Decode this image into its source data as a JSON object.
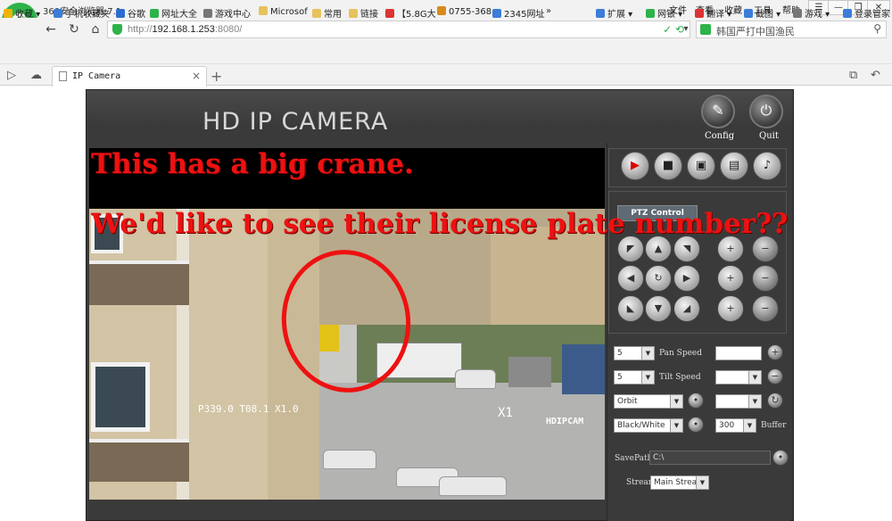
{
  "browser": {
    "logo_letter": "e",
    "app_title": "360安全浏览器 7.1",
    "menu": [
      "文件",
      "查看",
      "收藏",
      "工具",
      "帮助"
    ],
    "window_buttons": [
      "☰",
      "—",
      "❐",
      "✕"
    ],
    "url_scheme": "http://",
    "url_host": "192.168.1.253",
    "url_rest": ":8080/",
    "search_placeholder": "韩国严打中国渔民",
    "bookmarks": [
      "收藏",
      "手机收藏夹",
      "谷歌",
      "网址大全",
      "游戏中心",
      "Microsof",
      "常用",
      "链接",
      "【5.8G大",
      "0755-368",
      "2345网址"
    ],
    "bookmarks_right": [
      "扩展",
      "网银",
      "翻译",
      "截图",
      "游戏",
      "登录管家"
    ],
    "more_label": "»",
    "tab_label": "IP Camera",
    "tab_close": "×",
    "newtab": "+"
  },
  "camera": {
    "title": "HD IP CAMERA",
    "config_label": "Config",
    "quit_label": "Quit",
    "osd_left": "P339.0 T08.1 X1.0",
    "osd_zoom": "X1",
    "osd_brand": "HDIPCAM",
    "ptz_label": "PTZ Control",
    "pan_speed_value": "5",
    "pan_speed_label": "Pan Speed",
    "tilt_speed_value": "5",
    "tilt_speed_label": "Tilt Speed",
    "orbit_value": "Orbit",
    "color_mode_value": "Black/White",
    "buffer_value": "300",
    "buffer_label": "Buffer",
    "savepath_label": "SavePath",
    "savepath_value": "C:\\",
    "stream_label": "Stream",
    "stream_value": "Main Strea"
  },
  "annotations": {
    "line1": "This has a big crane.",
    "line2": "We'd like to see their license plate number??"
  }
}
